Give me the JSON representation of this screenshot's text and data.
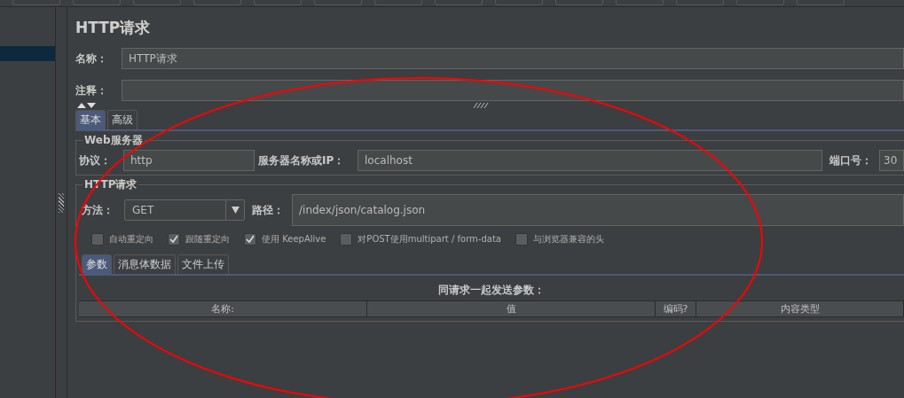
{
  "title": "HTTP请求",
  "name_field": {
    "label": "名称：",
    "value": "HTTP请求"
  },
  "comment_field": {
    "label": "注释："
  },
  "tabs": [
    {
      "label": "基本",
      "selected": true
    },
    {
      "label": "高级",
      "selected": false
    }
  ],
  "web_server": {
    "title": "Web服务器",
    "protocol_label": "协议：",
    "protocol": "http",
    "server_label": "服务器名称或IP：",
    "server": "localhost",
    "port_label": "端口号：",
    "port": "30"
  },
  "http_request": {
    "title": "HTTP请求",
    "method_label": "方法：",
    "method": "GET",
    "path_label": "路径：",
    "path": "/index/json/catalog.json",
    "options": [
      {
        "label": "自动重定向",
        "checked": false
      },
      {
        "label": "跟随重定向",
        "checked": true
      },
      {
        "label": "使用 KeepAlive",
        "checked": true
      },
      {
        "label": "对POST使用multipart / form-data",
        "checked": false
      },
      {
        "label": "与浏览器兼容的头",
        "checked": false
      }
    ]
  },
  "sub_tabs": [
    {
      "label": "参数",
      "selected": true
    },
    {
      "label": "消息体数据",
      "selected": false
    },
    {
      "label": "文件上传",
      "selected": false
    }
  ],
  "params_table": {
    "caption": "同请求一起发送参数：",
    "columns": [
      "名称:",
      "值",
      "编码?",
      "内容类型"
    ]
  },
  "annotation": {
    "kind": "ellipse",
    "color": "#ff0000"
  }
}
